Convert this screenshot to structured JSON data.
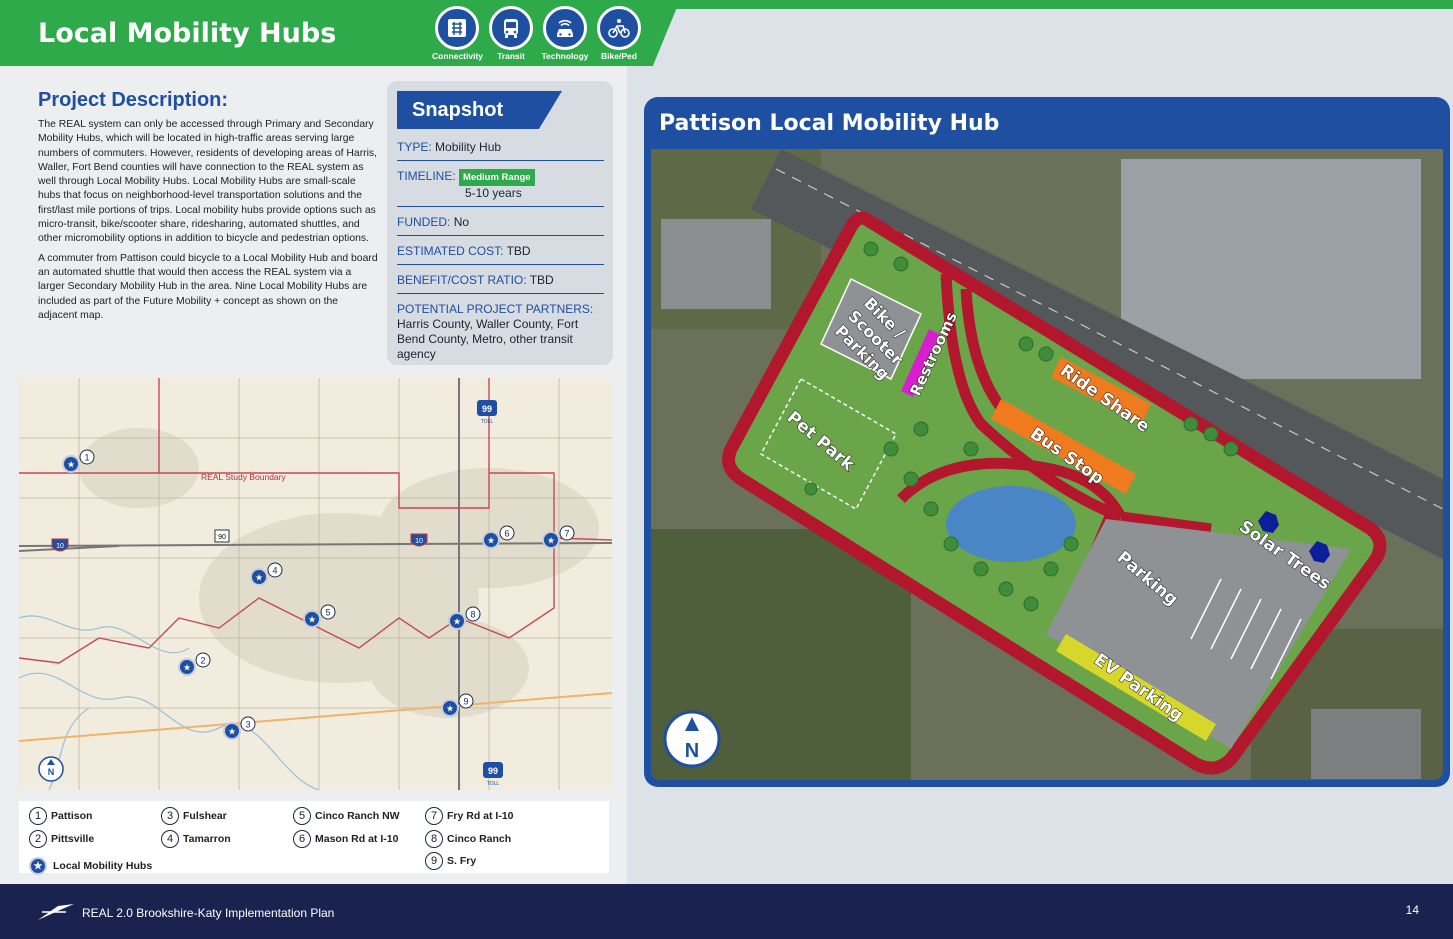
{
  "header": {
    "title": "Local Mobility Hubs",
    "categories": [
      {
        "label": "Connectivity",
        "icon": "connectivity-icon"
      },
      {
        "label": "Transit",
        "icon": "bus-icon"
      },
      {
        "label": "Technology",
        "icon": "car-tech-icon"
      },
      {
        "label": "Bike/Ped",
        "icon": "bike-icon"
      }
    ]
  },
  "description": {
    "heading": "Project Description:",
    "paragraph1": "The REAL system can only be accessed through Primary and Secondary Mobility Hubs, which will be located in high-traffic areas serving large numbers of commuters. However, residents of developing areas of Harris, Waller, Fort Bend counties will have connection to the REAL system as well through Local Mobility Hubs. Local Mobility Hubs are small-scale hubs that focus on neighborhood-level transportation solutions and the first/last mile portions of trips. Local mobility hubs provide options such as micro-transit, bike/scooter share, ridesharing, automated shuttles, and other micromobility options in addition to bicycle and pedestrian options.",
    "paragraph2": "A commuter from Pattison could bicycle to a Local Mobility Hub and board an automated shuttle that would then access the REAL system via a larger Secondary Mobility Hub in the area. Nine Local Mobility Hubs are included as part of the Future Mobility + concept as shown on the adjacent map."
  },
  "snapshot": {
    "title": "Snapshot",
    "type_label": "TYPE:",
    "type_value": "Mobility Hub",
    "timeline_label": "TIMELINE:",
    "timeline_badge": "Medium Range",
    "timeline_value": "5-10 years",
    "funded_label": "FUNDED:",
    "funded_value": "No",
    "cost_label": "ESTIMATED COST:",
    "cost_value": "TBD",
    "ratio_label": "BENEFIT/COST RATIO:",
    "ratio_value": "TBD",
    "partners_label": "POTENTIAL PROJECT PARTNERS:",
    "partners_value": "Harris County, Waller County, Fort Bend County, Metro, other transit agency"
  },
  "map": {
    "boundary_label": "REAL Study Boundary",
    "shields": [
      "99",
      "90",
      "10",
      "10",
      "99"
    ],
    "shield_sub": "TOLL",
    "north": "N",
    "hub_numbers": [
      "1",
      "2",
      "3",
      "4",
      "5",
      "6",
      "7",
      "8",
      "9"
    ]
  },
  "legend": {
    "items": [
      {
        "num": "1",
        "name": "Pattison"
      },
      {
        "num": "2",
        "name": "Pittsville"
      },
      {
        "num": "3",
        "name": "Fulshear"
      },
      {
        "num": "4",
        "name": "Tamarron"
      },
      {
        "num": "5",
        "name": "Cinco Ranch NW"
      },
      {
        "num": "6",
        "name": "Mason Rd at I-10"
      },
      {
        "num": "7",
        "name": "Fry Rd at I-10"
      },
      {
        "num": "8",
        "name": "Cinco Ranch"
      },
      {
        "num": "9",
        "name": "S. Fry"
      }
    ],
    "hub_symbol_label": "Local Mobility Hubs"
  },
  "hub_plan": {
    "title": "Pattison Local Mobility Hub",
    "labels": {
      "bike": "Bike /",
      "scooter": "Scooter",
      "parking_bike": "Parking",
      "restrooms": "Restrooms",
      "pet_park": "Pet Park",
      "ride_share": "Ride Share",
      "bus_stop": "Bus Stop",
      "parking": "Parking",
      "solar_trees": "Solar Trees",
      "ev_parking": "EV Parking"
    },
    "north": "N"
  },
  "footer": {
    "title": "REAL 2.0 Brookshire-Katy Implementation Plan",
    "page": "14"
  },
  "colors": {
    "brand_green": "#2eaa4a",
    "brand_blue": "#1e4fa1",
    "footer_navy": "#1a2350",
    "path_red": "#b3172d"
  }
}
